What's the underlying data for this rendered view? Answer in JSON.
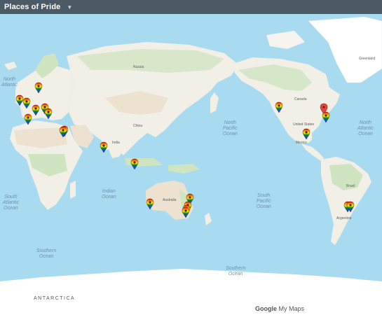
{
  "app": {
    "title": "Places of Pride",
    "menu_icon": "chevron-down-icon"
  },
  "ocean_labels": [
    {
      "id": "north-atlantic-left",
      "text": "North\nAtlantic"
    },
    {
      "id": "south-atlantic-left",
      "text": "South\nAtlantic\nOcean"
    },
    {
      "id": "indian-ocean",
      "text": "Indian\nOcean"
    },
    {
      "id": "north-pacific",
      "text": "North\nPacific\nOcean"
    },
    {
      "id": "south-pacific",
      "text": "South\nPacific\nOcean"
    },
    {
      "id": "north-atlantic-right",
      "text": "North\nAtlantic\nOcean"
    },
    {
      "id": "southern-ocean-left",
      "text": "Southern\nOcean"
    },
    {
      "id": "southern-ocean-right",
      "text": "Southern\nOcean"
    }
  ],
  "country_labels": [
    "Canada",
    "United States",
    "Mexico",
    "Brazil",
    "Argentina",
    "Australia",
    "China",
    "India",
    "Russia",
    "Greenland"
  ],
  "antarctica_label": "ANTARCTICA",
  "attribution": {
    "google": "Google",
    "product": "My Maps"
  },
  "colors": {
    "ocean": "#a9dbf0",
    "land": "#f1efe6",
    "forest": "#cfe4c0",
    "desert": "#ece2cf",
    "ice": "#ffffff",
    "topbar": "#4c5a66",
    "pin_selected": "#e0463f"
  },
  "markers": [
    {
      "name": "marker-uk-1",
      "selected": false
    },
    {
      "name": "marker-uk-2",
      "selected": false
    },
    {
      "name": "marker-scandinavia",
      "selected": false
    },
    {
      "name": "marker-france",
      "selected": false
    },
    {
      "name": "marker-germany",
      "selected": false
    },
    {
      "name": "marker-poland",
      "selected": false
    },
    {
      "name": "marker-hungary",
      "selected": false
    },
    {
      "name": "marker-spain",
      "selected": false
    },
    {
      "name": "marker-turkey",
      "selected": false
    },
    {
      "name": "marker-india",
      "selected": false
    },
    {
      "name": "marker-indonesia",
      "selected": false
    },
    {
      "name": "marker-west-australia",
      "selected": false
    },
    {
      "name": "marker-brisbane",
      "selected": false
    },
    {
      "name": "marker-sydney",
      "selected": false
    },
    {
      "name": "marker-canberra",
      "selected": false
    },
    {
      "name": "marker-melbourne",
      "selected": false
    },
    {
      "name": "marker-seattle",
      "selected": false
    },
    {
      "name": "marker-new-york-selected",
      "selected": true
    },
    {
      "name": "marker-washington",
      "selected": false
    },
    {
      "name": "marker-mexico",
      "selected": false
    },
    {
      "name": "marker-buenos-aires-1",
      "selected": false
    },
    {
      "name": "marker-buenos-aires-2",
      "selected": false
    }
  ]
}
